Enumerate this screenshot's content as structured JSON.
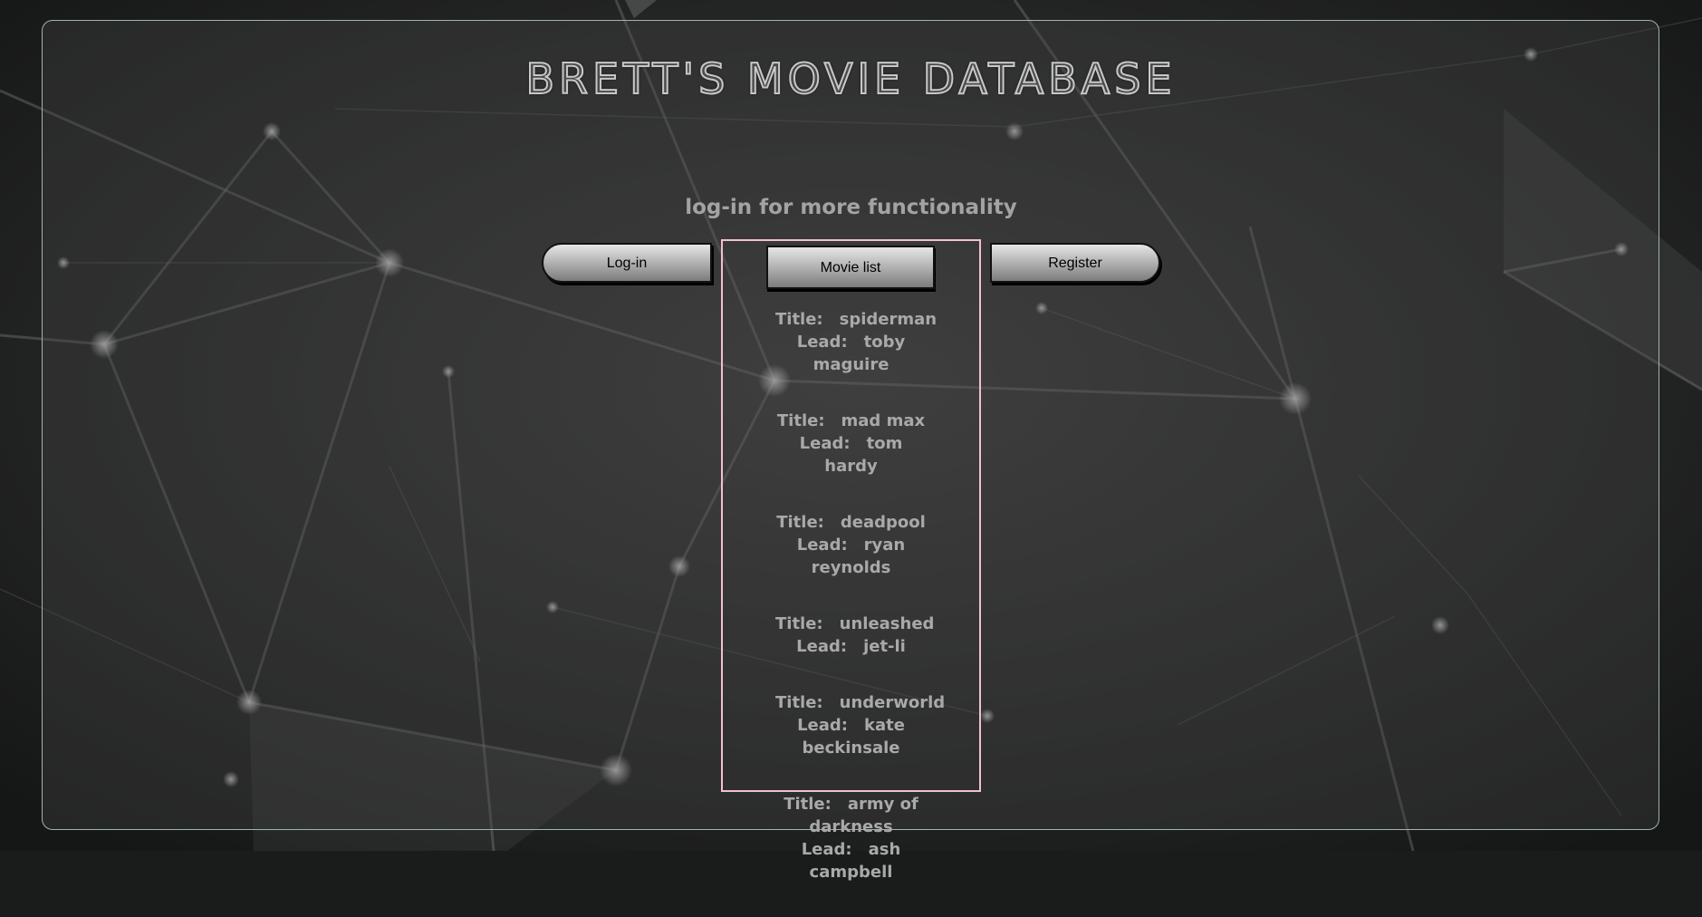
{
  "app": {
    "title": "BRETT'S MOVIE DATABASE",
    "subtitle": "log-in for more functionality"
  },
  "nav": {
    "login_label": "Log-in",
    "movies_label": "Movie list",
    "register_label": "Register"
  },
  "labels": {
    "title": "Title:",
    "lead": "Lead:"
  },
  "movies": [
    {
      "title": "spiderman",
      "lead": "toby maguire"
    },
    {
      "title": "mad max",
      "lead": "tom hardy"
    },
    {
      "title": "deadpool",
      "lead": "ryan reynolds"
    },
    {
      "title": "unleashed",
      "lead": "jet-li"
    },
    {
      "title": "underworld",
      "lead": "kate beckinsale"
    },
    {
      "title": "army of darkness",
      "lead": "ash campbell"
    }
  ],
  "colors": {
    "frame_border": "#9fb5b0",
    "panel_border": "#f2c0cc",
    "text": "#a9a9a9"
  }
}
